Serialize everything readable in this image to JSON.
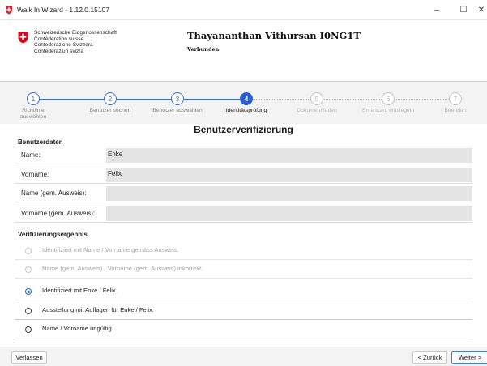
{
  "window": {
    "title": "Walk In Wizard - 1.12.0.15107",
    "minimize_symbol": "–",
    "maximize_symbol": "☐",
    "close_symbol": "✕"
  },
  "header": {
    "confederation_lines": [
      "Schweizerische Eidgenossenschaft",
      "Confédération suisse",
      "Confederazione Svizzera",
      "Confederaziun svizra"
    ],
    "user_name": "Thayananthan Vithursan I0NG1T",
    "connection_status": "Verbunden",
    "flag_color": "#e2001a"
  },
  "stepper": {
    "active_color": "#2d5fd0",
    "steps": [
      {
        "number": "1",
        "label_lines": [
          "Richtlinie",
          "auswählen"
        ],
        "state": "done"
      },
      {
        "number": "2",
        "label_lines": [
          "Benutzer suchen"
        ],
        "state": "done"
      },
      {
        "number": "3",
        "label_lines": [
          "Benutzer auswählen"
        ],
        "state": "done"
      },
      {
        "number": "4",
        "label_lines": [
          "Identitätsprüfung"
        ],
        "state": "active"
      },
      {
        "number": "5",
        "label_lines": [
          "Dokument laden"
        ],
        "state": "future"
      },
      {
        "number": "6",
        "label_lines": [
          "Smartcard entsiegeln"
        ],
        "state": "future"
      },
      {
        "number": "7",
        "label_lines": [
          "Beenden"
        ],
        "state": "future"
      }
    ]
  },
  "main": {
    "title": "Benutzerverifizierung",
    "userdata": {
      "heading": "Benutzerdaten",
      "fields": [
        {
          "label": "Name:",
          "value": "Enke"
        },
        {
          "label": "Vorname:",
          "value": "Felix"
        },
        {
          "label": "Name (gem. Ausweis):",
          "value": ""
        },
        {
          "label": "Vorname (gem. Ausweis):",
          "value": ""
        }
      ]
    },
    "result": {
      "heading": "Verifizierungsergebnis",
      "options": [
        {
          "label": "Identifiziert mit Name / Vorname gemäss Ausweis.",
          "enabled": false,
          "checked": false
        },
        {
          "label": "Name (gem. Ausweis) / Vorname (gem. Ausweis) inkorrekt.",
          "enabled": false,
          "checked": false
        },
        {
          "label": "Identifiziert mit Enke / Felix.",
          "enabled": true,
          "checked": true
        },
        {
          "label": "Ausstellung mit Auflagen für Enke / Felix.",
          "enabled": true,
          "checked": false
        },
        {
          "label": "Name / Vorname ungültig.",
          "enabled": true,
          "checked": false
        }
      ]
    }
  },
  "footer": {
    "leave_label": "Verlassen",
    "back_label": "< Zurück",
    "next_label": "Weiter >"
  }
}
